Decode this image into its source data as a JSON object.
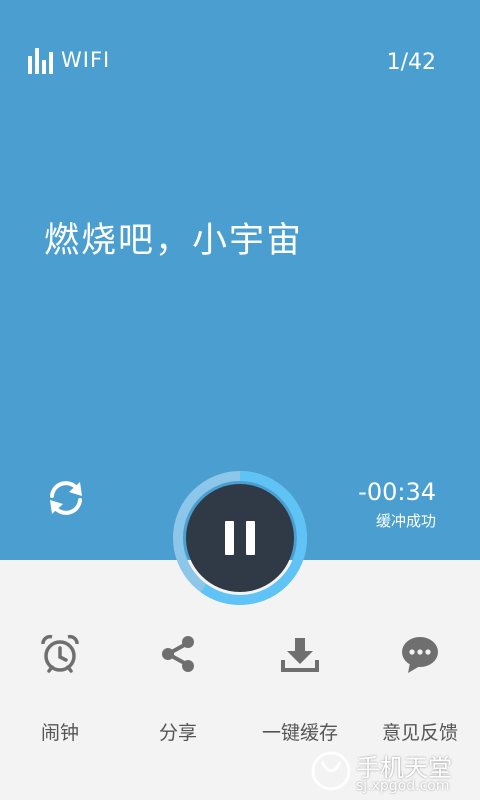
{
  "header": {
    "network_label": "WIFI",
    "track_counter": "1/42"
  },
  "track": {
    "title": "燃烧吧，小宇宙"
  },
  "playback": {
    "remaining_time": "-00:34",
    "buffer_status": "缓冲成功",
    "progress_fraction": 0.6
  },
  "actions": [
    {
      "label": "闹钟",
      "icon": "alarm-clock-icon"
    },
    {
      "label": "分享",
      "icon": "share-icon"
    },
    {
      "label": "一键缓存",
      "icon": "download-icon"
    },
    {
      "label": "意见反馈",
      "icon": "feedback-icon"
    }
  ],
  "watermark": {
    "name": "手机天堂",
    "url": "sj.xpgod.com"
  },
  "colors": {
    "top_background": "#4a9fd0",
    "bottom_background": "#f3f3f3",
    "button_dark": "#2f3a46",
    "ring_progress": "#5fc3f5",
    "icon_gray": "#6f6f6f"
  }
}
